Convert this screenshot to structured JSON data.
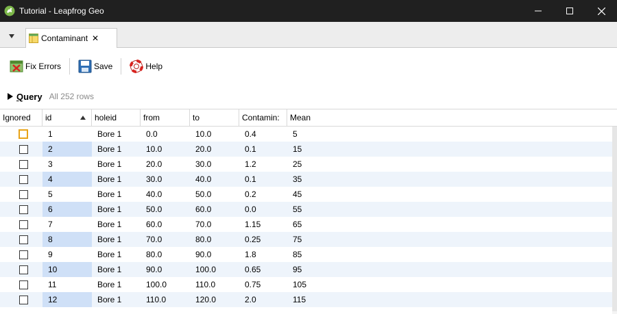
{
  "window": {
    "title": "Tutorial - Leapfrog Geo",
    "minimize_glyph": "—",
    "maximize_glyph": "☐",
    "close_glyph": "✕"
  },
  "tabs": [
    {
      "label": "Contaminant",
      "close_glyph": "✕",
      "icon": "table-icon"
    }
  ],
  "toolbar": {
    "fix_errors_label": "Fix Errors",
    "save_label": "Save",
    "help_label": "Help"
  },
  "query": {
    "label_first": "Q",
    "label_rest": "uery",
    "row_count": "All 252 rows"
  },
  "table": {
    "columns": [
      "Ignored",
      "id",
      "holeid",
      "from",
      "to",
      "Contamin:",
      "Mean"
    ],
    "sorted_column": "id",
    "rows": [
      {
        "id": "1",
        "holeid": "Bore 1",
        "from": "0.0",
        "to": "10.0",
        "contaminant": "0.4",
        "mean": "5"
      },
      {
        "id": "2",
        "holeid": "Bore 1",
        "from": "10.0",
        "to": "20.0",
        "contaminant": "0.1",
        "mean": "15"
      },
      {
        "id": "3",
        "holeid": "Bore 1",
        "from": "20.0",
        "to": "30.0",
        "contaminant": "1.2",
        "mean": "25"
      },
      {
        "id": "4",
        "holeid": "Bore 1",
        "from": "30.0",
        "to": "40.0",
        "contaminant": "0.1",
        "mean": "35"
      },
      {
        "id": "5",
        "holeid": "Bore 1",
        "from": "40.0",
        "to": "50.0",
        "contaminant": "0.2",
        "mean": "45"
      },
      {
        "id": "6",
        "holeid": "Bore 1",
        "from": "50.0",
        "to": "60.0",
        "contaminant": "0.0",
        "mean": "55"
      },
      {
        "id": "7",
        "holeid": "Bore 1",
        "from": "60.0",
        "to": "70.0",
        "contaminant": "1.15",
        "mean": "65"
      },
      {
        "id": "8",
        "holeid": "Bore 1",
        "from": "70.0",
        "to": "80.0",
        "contaminant": "0.25",
        "mean": "75"
      },
      {
        "id": "9",
        "holeid": "Bore 1",
        "from": "80.0",
        "to": "90.0",
        "contaminant": "1.8",
        "mean": "85"
      },
      {
        "id": "10",
        "holeid": "Bore 1",
        "from": "90.0",
        "to": "100.0",
        "contaminant": "0.65",
        "mean": "95"
      },
      {
        "id": "11",
        "holeid": "Bore 1",
        "from": "100.0",
        "to": "110.0",
        "contaminant": "0.75",
        "mean": "105"
      },
      {
        "id": "12",
        "holeid": "Bore 1",
        "from": "110.0",
        "to": "120.0",
        "contaminant": "2.0",
        "mean": "115"
      }
    ]
  },
  "colors": {
    "titlebar_bg": "#202020",
    "row_alt_bg": "#eef4fb",
    "id_alt_bg": "#cfe0f7",
    "focus_outline": "#e8a317"
  }
}
